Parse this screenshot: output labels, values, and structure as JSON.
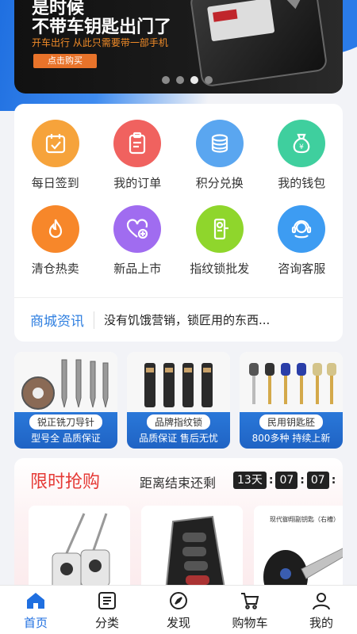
{
  "banner": {
    "line1": "是时候",
    "line2": "不带车钥匙出门了",
    "subtitle": "开车出行 从此只需要带一部手机",
    "button": "点击购买",
    "slide_count": 4,
    "active_slide": 3
  },
  "menu": {
    "items": [
      {
        "label": "每日签到",
        "icon": "calendar-check-icon",
        "color": "#f6a33b"
      },
      {
        "label": "我的订单",
        "icon": "order-list-icon",
        "color": "#f0625f"
      },
      {
        "label": "积分兑换",
        "icon": "coins-icon",
        "color": "#5aa6f0"
      },
      {
        "label": "我的钱包",
        "icon": "money-bag-icon",
        "color": "#3fcf9e"
      },
      {
        "label": "清仓热卖",
        "icon": "flame-icon",
        "color": "#f7872a"
      },
      {
        "label": "新品上市",
        "icon": "heart-plus-icon",
        "color": "#a06cf0"
      },
      {
        "label": "指纹锁批发",
        "icon": "fingerprint-lock-icon",
        "color": "#8fd62c"
      },
      {
        "label": "咨询客服",
        "icon": "customer-service-icon",
        "color": "#3d9cf2"
      }
    ]
  },
  "news": {
    "tag": "商城资讯",
    "text": "没有饥饿营销，锁匠用的东西..."
  },
  "categories": [
    {
      "title": "锐正铣刀导针",
      "subtitle": "型号全 品质保证"
    },
    {
      "title": "品牌指纹锁",
      "subtitle": "品质保证 售后无忧"
    },
    {
      "title": "民用钥匙胚",
      "subtitle": "800多种 持续上新"
    }
  ],
  "flash_sale": {
    "title": "限时抢购",
    "countdown_label": "距离结束还剩",
    "days": "13天",
    "hours": "07",
    "minutes": "07",
    "product_caption": "现代御翔副钥匙（右槽）"
  },
  "tabbar": {
    "items": [
      {
        "label": "首页",
        "icon": "home-icon",
        "active": true
      },
      {
        "label": "分类",
        "icon": "category-icon",
        "active": false
      },
      {
        "label": "发现",
        "icon": "discover-icon",
        "active": false
      },
      {
        "label": "购物车",
        "icon": "cart-icon",
        "active": false
      },
      {
        "label": "我的",
        "icon": "profile-icon",
        "active": false
      }
    ]
  },
  "colors": {
    "primary": "#1f6fe0",
    "flash_red": "#e53935"
  }
}
